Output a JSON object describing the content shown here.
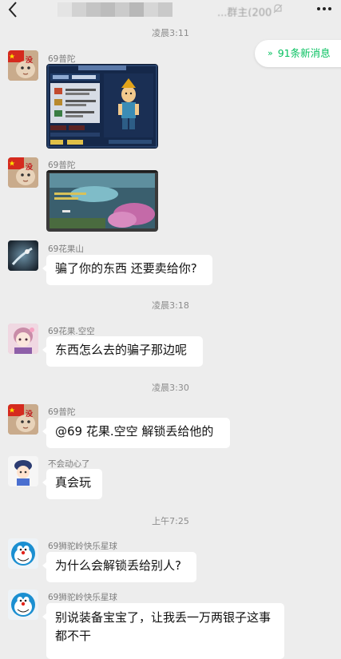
{
  "header": {
    "title": "...群主(200)",
    "back_icon": "chevron-left-icon",
    "more_icon": "more-dots-icon",
    "mute_icon": "bell-off-icon"
  },
  "new_messages": {
    "label": "91条新消息",
    "icon": "double-chevron-up-icon",
    "color": "#07c160"
  },
  "timestamps": [
    "凌晨3:11",
    "凌晨3:18",
    "凌晨3:30",
    "上午7:25"
  ],
  "messages": [
    {
      "sender": "69普陀",
      "type": "image"
    },
    {
      "sender": "69普陀",
      "type": "image"
    },
    {
      "sender": "69花果山",
      "text": "骗了你的东西 还要卖给你?"
    },
    {
      "sender": "69花果.空空",
      "text": "东西怎么去的骗子那边呢"
    },
    {
      "sender": "69普陀",
      "text": "@69 花果.空空  解锁丢给他的"
    },
    {
      "sender": "不会动心了",
      "text": "真会玩"
    },
    {
      "sender": "69狮驼岭快乐星球",
      "text": "为什么会解锁丢给别人?"
    },
    {
      "sender": "69狮驼岭快乐星球",
      "text": "别说装备宝宝了，让我丢一万两银子这事都不干"
    }
  ]
}
